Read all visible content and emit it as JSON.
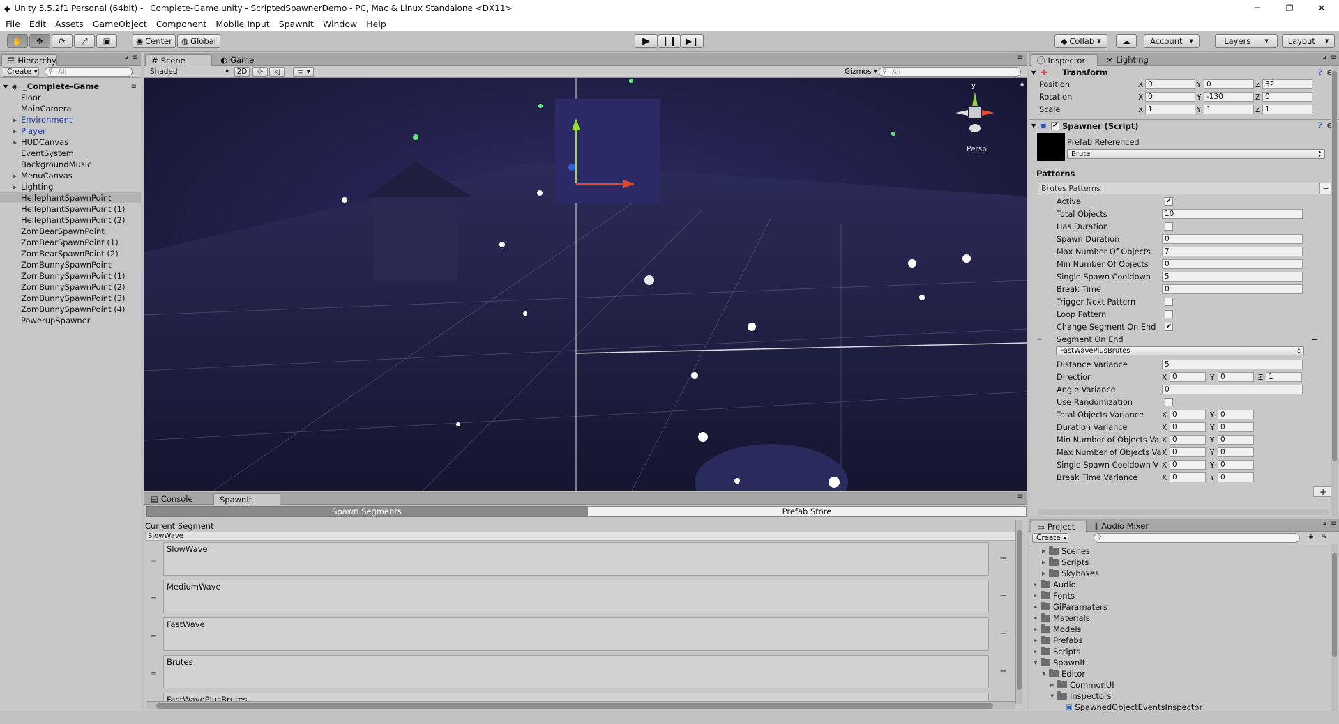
{
  "window": {
    "title": "Unity 5.5.2f1 Personal (64bit) - _Complete-Game.unity - ScriptedSpawnerDemo - PC, Mac & Linux Standalone <DX11>",
    "min": "─",
    "max": "❐",
    "close": "✕"
  },
  "menu": [
    "File",
    "Edit",
    "Assets",
    "GameObject",
    "Component",
    "Mobile Input",
    "SpawnIt",
    "Window",
    "Help"
  ],
  "toolbar": {
    "center": "Center",
    "global": "Global",
    "collab": "Collab",
    "account": "Account",
    "layers": "Layers",
    "layout": "Layout"
  },
  "hierarchy": {
    "tab": "Hierarchy",
    "create": "Create",
    "search_placeholder": "All",
    "scene": "_Complete-Game",
    "items": [
      {
        "label": "Floor",
        "expand": false,
        "prefab": false
      },
      {
        "label": "MainCamera",
        "expand": false,
        "prefab": false
      },
      {
        "label": "Environment",
        "expand": true,
        "prefab": true
      },
      {
        "label": "Player",
        "expand": true,
        "prefab": true
      },
      {
        "label": "HUDCanvas",
        "expand": true,
        "prefab": false
      },
      {
        "label": "EventSystem",
        "expand": false,
        "prefab": false
      },
      {
        "label": "BackgroundMusic",
        "expand": false,
        "prefab": false
      },
      {
        "label": "MenuCanvas",
        "expand": true,
        "prefab": false
      },
      {
        "label": "Lighting",
        "expand": true,
        "prefab": false
      },
      {
        "label": "HellephantSpawnPoint",
        "expand": false,
        "prefab": false,
        "selected": true
      },
      {
        "label": "HellephantSpawnPoint (1)",
        "expand": false,
        "prefab": false
      },
      {
        "label": "HellephantSpawnPoint (2)",
        "expand": false,
        "prefab": false
      },
      {
        "label": "ZomBearSpawnPoint",
        "expand": false,
        "prefab": false
      },
      {
        "label": "ZomBearSpawnPoint (1)",
        "expand": false,
        "prefab": false
      },
      {
        "label": "ZomBearSpawnPoint (2)",
        "expand": false,
        "prefab": false
      },
      {
        "label": "ZomBunnySpawnPoint",
        "expand": false,
        "prefab": false
      },
      {
        "label": "ZomBunnySpawnPoint (1)",
        "expand": false,
        "prefab": false
      },
      {
        "label": "ZomBunnySpawnPoint (2)",
        "expand": false,
        "prefab": false
      },
      {
        "label": "ZomBunnySpawnPoint (3)",
        "expand": false,
        "prefab": false
      },
      {
        "label": "ZomBunnySpawnPoint (4)",
        "expand": false,
        "prefab": false
      },
      {
        "label": "PowerupSpawner",
        "expand": false,
        "prefab": false
      }
    ]
  },
  "scene": {
    "tab_scene": "Scene",
    "tab_game": "Game",
    "shaded": "Shaded",
    "mode2d": "2D",
    "gizmos": "Gizmos",
    "search_placeholder": "All",
    "persp": "Persp",
    "axis_y": "y"
  },
  "inspector": {
    "tab": "Inspector",
    "tab2": "Lighting",
    "transform": {
      "title": "Transform",
      "rows": [
        {
          "label": "Position",
          "x": "0",
          "y": "0",
          "z": "32"
        },
        {
          "label": "Rotation",
          "x": "0",
          "y": "-130",
          "z": "0"
        },
        {
          "label": "Scale",
          "x": "1",
          "y": "1",
          "z": "1"
        }
      ]
    },
    "spawner": {
      "title": "Spawner (Script)",
      "prefab_label": "Prefab Referenced",
      "prefab_value": "Brute",
      "patterns": "Patterns",
      "list_title": "Brutes Patterns",
      "fields": [
        {
          "label": "Active",
          "type": "check",
          "value": "✔"
        },
        {
          "label": "Total Objects",
          "type": "text",
          "value": "10"
        },
        {
          "label": "Has Duration",
          "type": "check",
          "value": ""
        },
        {
          "label": "Spawn Duration",
          "type": "text",
          "value": "0"
        },
        {
          "label": "Max Number Of Objects",
          "type": "text",
          "value": "7"
        },
        {
          "label": "Min Number Of Objects",
          "type": "text",
          "value": "0"
        },
        {
          "label": "Single Spawn Cooldown",
          "type": "text",
          "value": "5"
        },
        {
          "label": "Break Time",
          "type": "text",
          "value": "0"
        },
        {
          "label": "Trigger Next Pattern",
          "type": "check",
          "value": ""
        },
        {
          "label": "Loop Pattern",
          "type": "check",
          "value": ""
        },
        {
          "label": "Change Segment On End",
          "type": "check",
          "value": "✔"
        }
      ],
      "segment_on_end": "Segment On End",
      "segment_value": "FastWavePlusBrutes",
      "distance_variance": {
        "label": "Distance Variance",
        "value": "5"
      },
      "direction": {
        "label": "Direction",
        "x": "0",
        "y": "0",
        "z": "1"
      },
      "angle_variance": {
        "label": "Angle Variance",
        "value": "0"
      },
      "use_randomization": {
        "label": "Use Randomization",
        "value": ""
      },
      "variances": [
        {
          "label": "Total Objects Variance",
          "x": "0",
          "y": "0"
        },
        {
          "label": "Duration Variance",
          "x": "0",
          "y": "0"
        },
        {
          "label": "Min Number of Objects Va",
          "x": "0",
          "y": "0"
        },
        {
          "label": "Max Number of Objects Va",
          "x": "0",
          "y": "0"
        },
        {
          "label": "Single Spawn Cooldown V",
          "x": "0",
          "y": "0"
        },
        {
          "label": "Break Time Variance",
          "x": "0",
          "y": "0"
        }
      ],
      "add": "+",
      "remove": "−"
    }
  },
  "console": {
    "tab": "Console",
    "tab2": "SpawnIt",
    "btn1": "Spawn Segments",
    "btn2": "Prefab Store",
    "current": "Current Segment",
    "current_value": "SlowWave",
    "segments": [
      "SlowWave",
      "MediumWave",
      "FastWave",
      "Brutes",
      "FastWavePlusBrutes"
    ]
  },
  "project": {
    "tab": "Project",
    "tab2": "Audio Mixer",
    "create": "Create",
    "items": [
      {
        "label": "Scenes",
        "depth": 1,
        "tri": "▶"
      },
      {
        "label": "Scripts",
        "depth": 1,
        "tri": "▶"
      },
      {
        "label": "Skyboxes",
        "depth": 1,
        "tri": "▶"
      },
      {
        "label": "Audio",
        "depth": 0,
        "tri": "▶"
      },
      {
        "label": "Fonts",
        "depth": 0,
        "tri": "▶"
      },
      {
        "label": "GiParamaters",
        "depth": 0,
        "tri": "▶"
      },
      {
        "label": "Materials",
        "depth": 0,
        "tri": "▶"
      },
      {
        "label": "Models",
        "depth": 0,
        "tri": "▶"
      },
      {
        "label": "Prefabs",
        "depth": 0,
        "tri": "▶"
      },
      {
        "label": "Scripts",
        "depth": 0,
        "tri": "▶"
      },
      {
        "label": "SpawnIt",
        "depth": 0,
        "tri": "▼"
      },
      {
        "label": "Editor",
        "depth": 1,
        "tri": "▼"
      },
      {
        "label": "CommonUI",
        "depth": 2,
        "tri": "▶"
      },
      {
        "label": "Inspectors",
        "depth": 2,
        "tri": "▼"
      },
      {
        "label": "SpawnedObjectEventsInspector",
        "depth": 3,
        "tri": "",
        "file": true
      }
    ]
  }
}
